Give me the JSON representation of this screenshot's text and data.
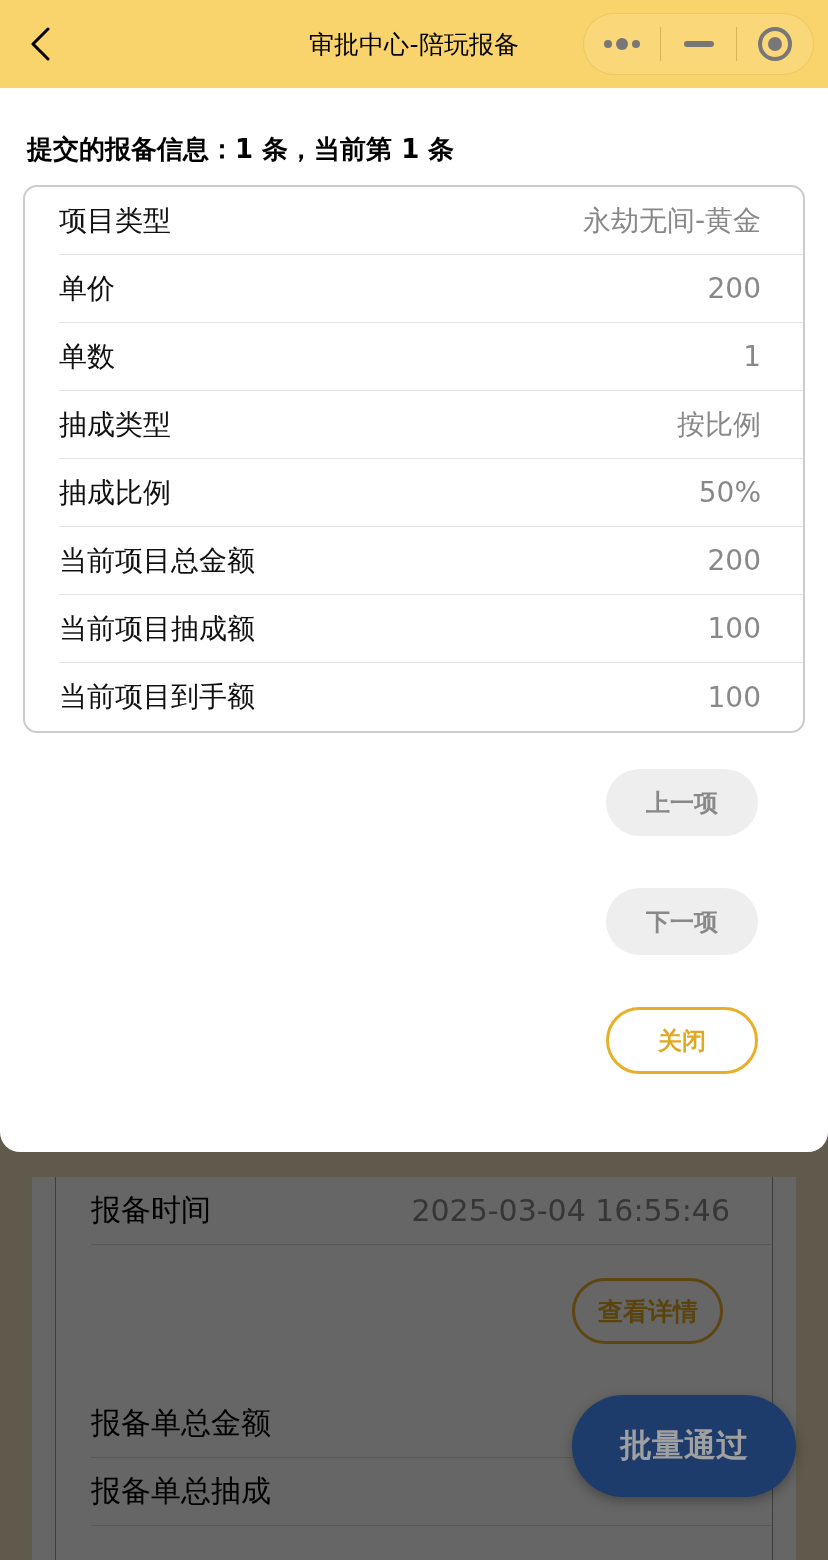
{
  "nav_bar": {
    "title": "审批中心-陪玩报备"
  },
  "dialog": {
    "heading": "提交的报备信息：1 条，当前第 1 条",
    "rows": [
      {
        "label": "项目类型",
        "value": "永劫无间-黄金"
      },
      {
        "label": "单价",
        "value": "200"
      },
      {
        "label": "单数",
        "value": "1"
      },
      {
        "label": "抽成类型",
        "value": "按比例"
      },
      {
        "label": "抽成比例",
        "value": "50%"
      },
      {
        "label": "当前项目总金额",
        "value": "200"
      },
      {
        "label": "当前项目抽成额",
        "value": "100"
      },
      {
        "label": "当前项目到手额",
        "value": "100"
      }
    ],
    "buttons": [
      {
        "label": "上一项",
        "kind": "secondary"
      },
      {
        "label": "下一项",
        "kind": "secondary"
      },
      {
        "label": "关闭",
        "kind": "outline"
      }
    ]
  },
  "background_page": {
    "rows": [
      {
        "label": "报备时间",
        "value": "2025-03-04 16:55:46"
      }
    ],
    "detail_button": "查看详情",
    "summary_rows": [
      {
        "label": "报备单总金额"
      },
      {
        "label": "报备单总抽成"
      }
    ]
  },
  "fab": "批量通过"
}
